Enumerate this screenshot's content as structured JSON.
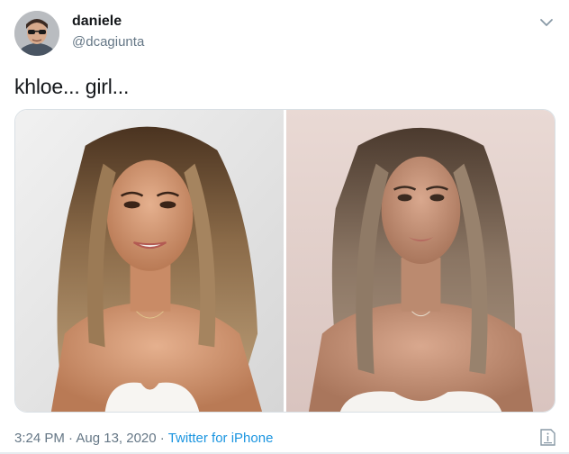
{
  "tweet": {
    "author": {
      "display_name": "daniele",
      "handle": "@dcagiunta",
      "avatar_icon": "avatar-photo"
    },
    "more_menu_icon": "chevron-down-icon",
    "text": "khloe... girl...",
    "media": [
      {
        "icon": "photo-left"
      },
      {
        "icon": "photo-right"
      }
    ],
    "timestamp": "3:24 PM · Aug 13, 2020",
    "separator": " · ",
    "source": "Twitter for iPhone",
    "info_icon": "tweet-info-icon"
  },
  "colors": {
    "name": "#14171a",
    "secondary": "#657786",
    "link": "#1b95e0",
    "border": "#e6ecf0"
  }
}
